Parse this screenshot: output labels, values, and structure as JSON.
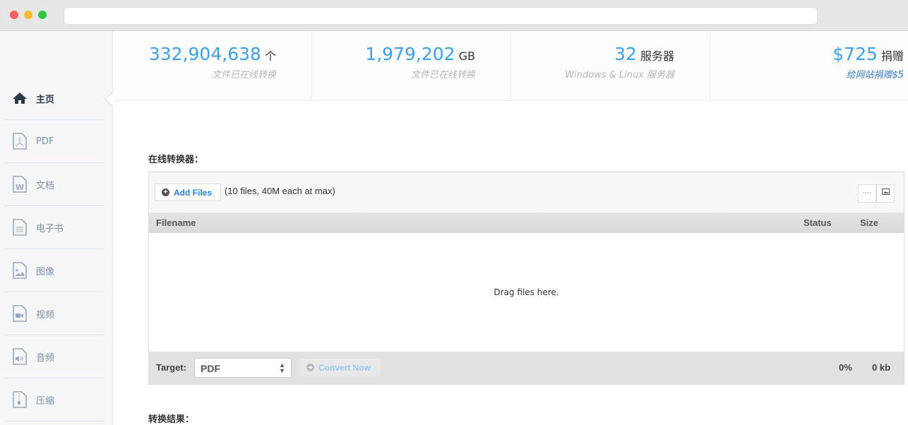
{
  "sidebar": {
    "items": [
      {
        "label": "主页",
        "icon": "home-icon"
      },
      {
        "label": "PDF",
        "icon": "pdf-file-icon"
      },
      {
        "label": "文档",
        "icon": "word-file-icon"
      },
      {
        "label": "电子书",
        "icon": "text-file-icon"
      },
      {
        "label": "图像",
        "icon": "image-file-icon"
      },
      {
        "label": "视频",
        "icon": "video-file-icon"
      },
      {
        "label": "音频",
        "icon": "audio-file-icon"
      },
      {
        "label": "压缩",
        "icon": "archive-file-icon"
      }
    ]
  },
  "stats": [
    {
      "value": "332,904,638",
      "unit": "个",
      "caption": "文件已在线转换"
    },
    {
      "value": "1,979,202",
      "unit": "GB",
      "caption": "文件已在线转换"
    },
    {
      "value": "32",
      "unit": "服务器",
      "caption": "Windows & Linux 服务器"
    },
    {
      "value": "$725",
      "unit": "捐赠",
      "caption": "给网站捐赠$5"
    }
  ],
  "converter": {
    "title": "在线转换器：",
    "add_files": "Add Files",
    "limit": "(10 files, 40M each at max)",
    "columns": {
      "filename": "Filename",
      "status": "Status",
      "size": "Size"
    },
    "empty": "Drag files here.",
    "target_label": "Target:",
    "target_value": "PDF",
    "convert": "Convert Now",
    "progress": "0%",
    "total_size": "0 kb"
  },
  "results_title": "转换结果：",
  "colors": {
    "accent": "#3ca0ea",
    "link": "#2a7ed6"
  }
}
